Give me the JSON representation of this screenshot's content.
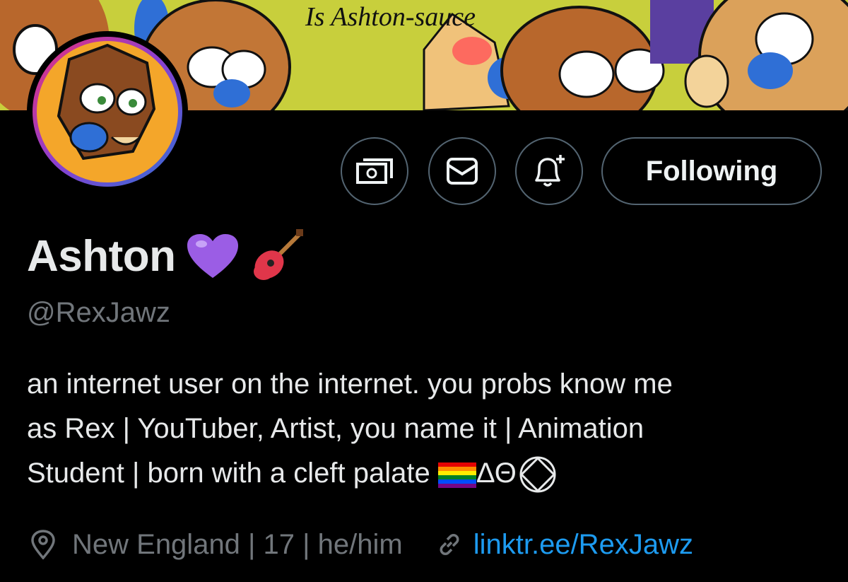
{
  "banner": {
    "caption": "Is Ashton-sauce"
  },
  "profile": {
    "display_name": "Ashton",
    "handle": "@RexJawz",
    "name_emojis": [
      "purple-heart",
      "guitar"
    ]
  },
  "actions": {
    "tip_icon": "money-icon",
    "message_icon": "envelope-icon",
    "notify_icon": "bell-plus-icon",
    "follow_label": "Following"
  },
  "bio": {
    "line1": "an internet user on the internet. you probs know me",
    "line2": "as Rex | YouTuber, Artist, you name it | Animation",
    "line3_text": "Student | born with a cleft palate ",
    "line3_symbols": "ΔΘ"
  },
  "meta": {
    "location": "New England | 17 | he/him",
    "link": "linktr.ee/RexJawz"
  },
  "colors": {
    "background": "#000000",
    "muted": "#71767b",
    "link": "#1d9bf0",
    "border": "#536471",
    "banner": "#c9d13a"
  }
}
